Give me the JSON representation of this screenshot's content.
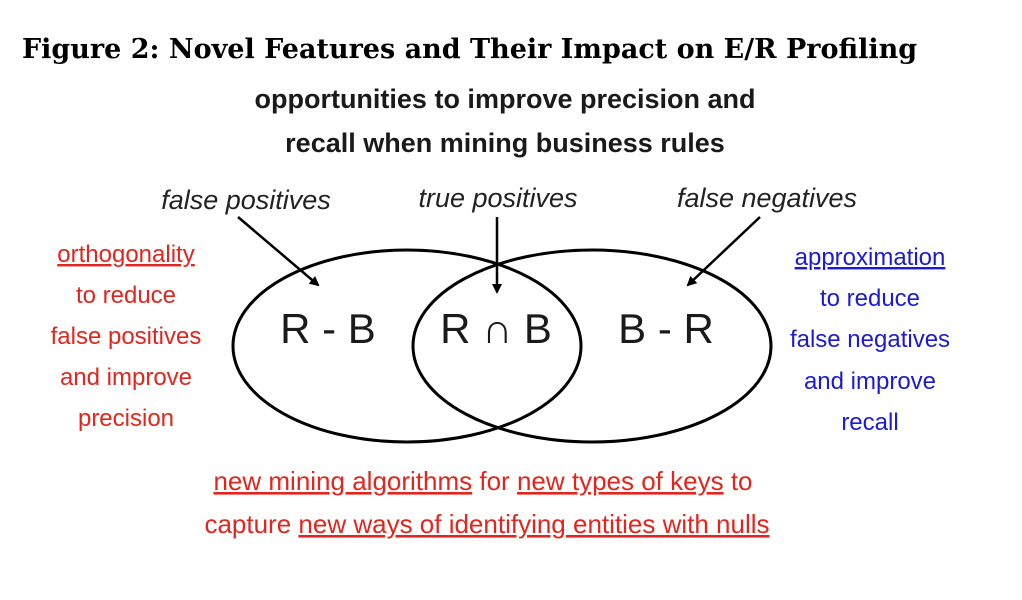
{
  "figure": {
    "title": "Figure 2: Novel Features and Their Impact on E/R Profiling",
    "subtitle_line1": "opportunities to improve precision and",
    "subtitle_line2": "recall when mining business rules"
  },
  "labels": {
    "false_positives": "false positives",
    "true_positives": "true positives",
    "false_negatives": "false negatives"
  },
  "sets": {
    "r_minus_b": "R - B",
    "r_intersect_b": "R ∩ B",
    "b_minus_r": "B - R"
  },
  "left_note": {
    "lines": [
      "orthogonality",
      "to reduce",
      "false positives",
      "and improve",
      "precision"
    ],
    "color": "#e0261e"
  },
  "right_note": {
    "lines": [
      "approximation",
      "to reduce",
      "false negatives",
      "and improve",
      "recall"
    ],
    "color": "#1c1ad6"
  },
  "bottom_note": {
    "line1": [
      "new mining algorithms",
      " for ",
      "new types of keys",
      " to"
    ],
    "line2": [
      "capture ",
      "new ways of identifying entities with nulls"
    ]
  }
}
